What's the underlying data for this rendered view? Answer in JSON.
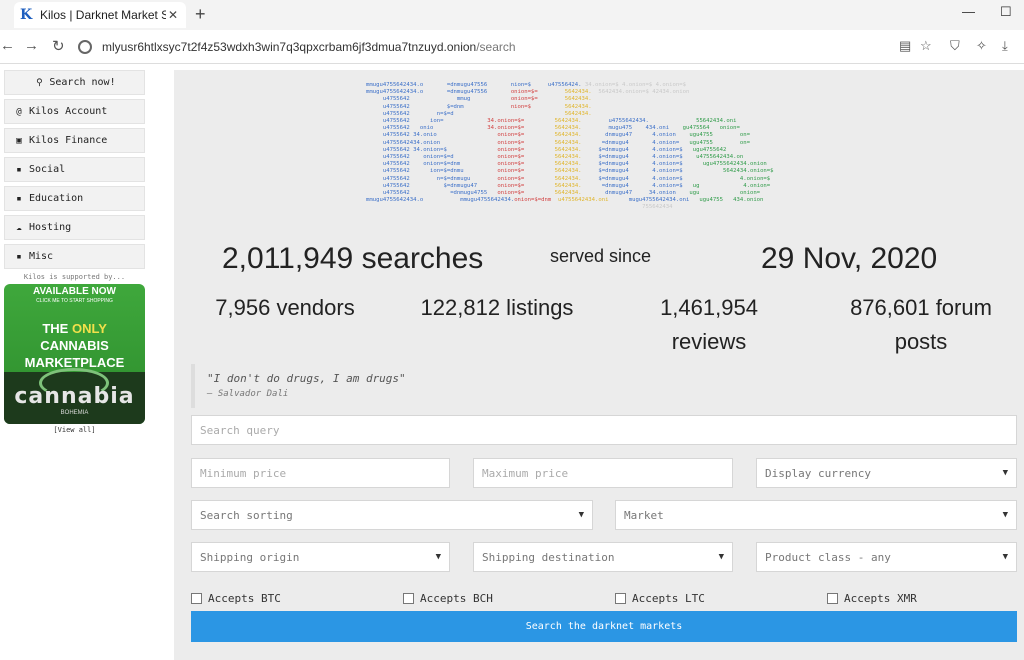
{
  "browser": {
    "tab_title": "Kilos | Darknet Market Search",
    "tab_favicon": "K",
    "url_host": "mlyusr6htlxsyc7t2f4z53wdxh3win7q3qpxcrbam6jf3dmua7tnzuyd.onion",
    "url_path": "/search",
    "icons": {
      "back": "arrow-left-icon",
      "forward": "arrow-right-icon",
      "reload": "reload-icon",
      "reader": "reader-icon",
      "bookmark": "star-icon",
      "shield": "shield-icon",
      "extension": "extension-icon",
      "download": "download-icon"
    }
  },
  "sidebar": {
    "search_now": "Search now!",
    "items": [
      {
        "label": "Kilos Account",
        "icon": "@"
      },
      {
        "label": "Kilos Finance",
        "icon": "▣"
      },
      {
        "label": "Social",
        "icon": "▪"
      },
      {
        "label": "Education",
        "icon": "▪"
      },
      {
        "label": "Hosting",
        "icon": "☁"
      },
      {
        "label": "Misc",
        "icon": "▪"
      }
    ],
    "supported_by": "Kilos is supported by...",
    "ad": {
      "available": "AVAILABLE NOW",
      "click": "CLICK ME TO START SHOPPING",
      "headline_pre": "THE ",
      "headline_only": "ONLY",
      "headline_post": " CANNABIS MARKETPLACE",
      "brand": "cannabia",
      "sub": "BOHEMIA"
    },
    "view_all": "[View all]"
  },
  "stats": {
    "searches": "2,011,949 searches",
    "served_since": "served since",
    "date": "29 Nov, 2020",
    "vendors": "7,956 vendors",
    "listings": "122,812 listings",
    "reviews_num": "1,461,954",
    "reviews_word": "reviews",
    "forum_num": "876,601 forum",
    "forum_word": "posts"
  },
  "quote": {
    "text": "\"I don't do drugs, I am drugs\"",
    "author": "— Salvador Dali"
  },
  "form": {
    "search_placeholder": "Search query",
    "min_price_placeholder": "Minimum price",
    "max_price_placeholder": "Maximum price",
    "currency": "Display currency",
    "sorting": "Search sorting",
    "market": "Market",
    "shipping_origin": "Shipping origin",
    "shipping_destination": "Shipping destination",
    "product_class": "Product class - any",
    "checkboxes": [
      "Accepts BTC",
      "Accepts BCH",
      "Accepts LTC",
      "Accepts XMR"
    ],
    "submit": "Search the darknet markets"
  }
}
